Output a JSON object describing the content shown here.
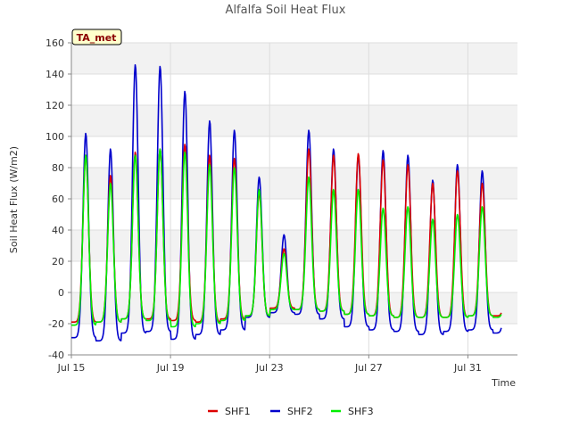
{
  "chart_data": {
    "type": "line",
    "title": "Alfalfa Soil Heat Flux",
    "xlabel": "Time",
    "ylabel": "Soil Heat Flux (W/m2)",
    "badge": "TA_met",
    "xlim": [
      15.0,
      33.0
    ],
    "ylim": [
      -40,
      160
    ],
    "yticks": [
      -40,
      -20,
      0,
      20,
      40,
      60,
      80,
      100,
      120,
      140,
      160
    ],
    "xticks": [
      {
        "value": 15,
        "label": "Jul 15"
      },
      {
        "value": 19,
        "label": "Jul 19"
      },
      {
        "value": 23,
        "label": "Jul 23"
      },
      {
        "value": 27,
        "label": "Jul 27"
      },
      {
        "value": 31,
        "label": "Jul 31"
      }
    ],
    "day_offset": 15,
    "grid": true,
    "legend_position": "bottom",
    "series": [
      {
        "name": "SHF1",
        "color": "#dd0000",
        "daily_min": [
          -19,
          -19,
          -17,
          -17,
          -18,
          -19,
          -17,
          -15,
          -10,
          -11,
          -12,
          -14,
          -15,
          -16,
          -16,
          -16,
          -15,
          -15
        ],
        "daily_peak": [
          88,
          75,
          90,
          92,
          95,
          88,
          86,
          64,
          28,
          92,
          88,
          89,
          85,
          82,
          70,
          78,
          70,
          0
        ]
      },
      {
        "name": "SHF2",
        "color": "#0000cc",
        "daily_min": [
          -29,
          -31,
          -26,
          -25,
          -30,
          -27,
          -24,
          -16,
          -13,
          -14,
          -17,
          -22,
          -24,
          -25,
          -27,
          -25,
          -24,
          -26
        ],
        "daily_peak": [
          102,
          92,
          146,
          145,
          129,
          110,
          104,
          74,
          37,
          104,
          92,
          88,
          91,
          88,
          72,
          82,
          78,
          0
        ]
      },
      {
        "name": "SHF3",
        "color": "#00ee00",
        "daily_min": [
          -21,
          -19,
          -17,
          -18,
          -22,
          -20,
          -18,
          -15,
          -11,
          -11,
          -12,
          -14,
          -15,
          -16,
          -16,
          -16,
          -15,
          -16
        ],
        "daily_peak": [
          88,
          70,
          88,
          92,
          90,
          82,
          80,
          66,
          25,
          74,
          66,
          66,
          54,
          55,
          47,
          50,
          55,
          0
        ]
      }
    ]
  }
}
